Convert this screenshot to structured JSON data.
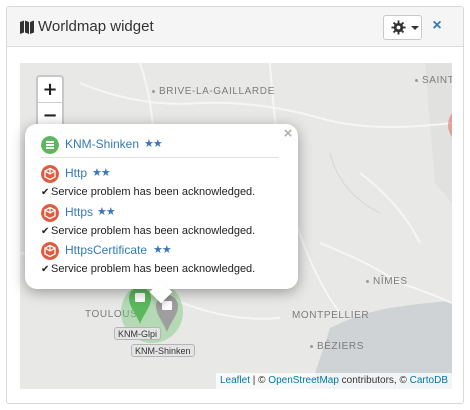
{
  "widget": {
    "title": "Worldmap widget",
    "title_icon": "map-icon",
    "settings_icon": "gear-icon",
    "close_label": "×"
  },
  "map": {
    "zoom_in_label": "+",
    "zoom_out_label": "−",
    "cities": {
      "brive": "BRIVE-LA-GAILLARDE",
      "saint": "SAINT-",
      "nimes": "NÎMES",
      "montpellier": "MONTPELLIER",
      "beziers": "BÉZIERS",
      "toulouse": "TOULOUS"
    },
    "marker_labels": {
      "glpi": "KNM-Glpi",
      "shinken": "KNM-Shinken"
    },
    "attribution": {
      "leaflet": "Leaflet",
      "sep1": " | © ",
      "osm": "OpenStreetMap",
      "sep2": " contributors, © ",
      "carto": "CartoDB"
    },
    "colors": {
      "cluster_red": "#e05a4f",
      "cluster_green": "#5cb85c",
      "marker_grey": "#9e9e9e"
    }
  },
  "popup": {
    "close_label": "×",
    "host": {
      "name": "KNM-Shinken",
      "stars": "★★",
      "status_color": "#5cb85c",
      "icon": "server-icon"
    },
    "services": [
      {
        "name": "Http",
        "stars": "★★",
        "status_color": "#e05a3d",
        "icon": "cube-icon",
        "message": "Service problem has been acknowledged."
      },
      {
        "name": "Https",
        "stars": "★★",
        "status_color": "#e05a3d",
        "icon": "cube-icon",
        "message": "Service problem has been acknowledged."
      },
      {
        "name": "HttpsCertificate",
        "stars": "★★",
        "status_color": "#e05a3d",
        "icon": "cube-icon",
        "message": "Service problem has been acknowledged."
      }
    ]
  }
}
